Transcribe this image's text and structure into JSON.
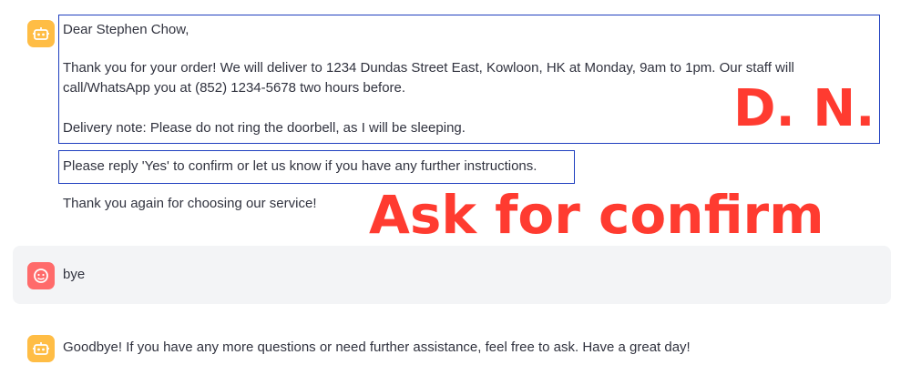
{
  "chat": {
    "assistant_message_1": {
      "greeting": "Dear Stephen Chow,",
      "body": "Thank you for your order! We will deliver to 1234 Dundas Street East, Kowloon, HK at Monday, 9am to 1pm. Our staff will call/WhatsApp you at (852) 1234-5678 two hours before.",
      "delivery_note": "Delivery note: Please do not ring the doorbell, as I will be sleeping.",
      "confirm_request": "Please reply 'Yes' to confirm or let us know if you have any further instructions.",
      "thanks": "Thank you again for choosing our service!"
    },
    "user_message": {
      "text": "bye"
    },
    "assistant_message_2": {
      "text": "Goodbye! If you have any more questions or need further assistance, feel free to ask. Have a great day!"
    }
  },
  "annotations": {
    "dn_label": "D. N.",
    "confirm_label": "Ask for confirm",
    "color": "#ff3b30",
    "box_color": "#1f3fbf"
  },
  "icons": {
    "assistant_avatar": "robot-icon",
    "user_avatar": "face-icon"
  },
  "colors": {
    "assistant_avatar_bg": "#ffbd45",
    "user_avatar_bg": "#ff6b6b",
    "user_row_bg": "#f3f4f6"
  }
}
